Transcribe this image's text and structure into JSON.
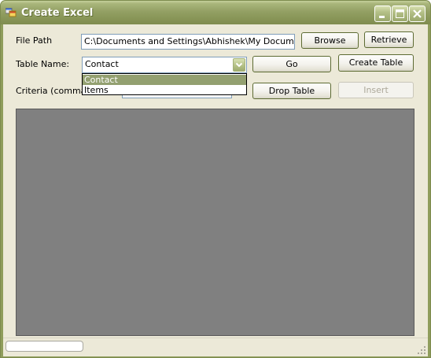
{
  "window": {
    "title": "Create Excel",
    "app_icon": "windows-form-icon",
    "caption_buttons": [
      "minimize-icon",
      "maximize-icon",
      "close-icon"
    ]
  },
  "form": {
    "file_path_label": "File Path",
    "file_path_value": "C:\\Documents and Settings\\Abhishek\\My Documents\\",
    "browse_label": "Browse",
    "retrieve_label": "Retrieve",
    "table_name_label": "Table Name:",
    "table_name_selected": "Contact",
    "go_label": "Go",
    "create_table_label": "Create Table",
    "criteria_label": "Criteria (comma se",
    "criteria_value": "",
    "drop_table_label": "Drop Table",
    "insert_label": "Insert",
    "insert_enabled": false
  },
  "dropdown": {
    "open": true,
    "options": [
      "Contact",
      "Items"
    ],
    "highlighted_index": 0
  },
  "status_bar": {
    "panel_text": ""
  },
  "colors": {
    "titlebar": "#8f9d5c",
    "dialog_background": "#ece9d8",
    "grid_background": "#808080",
    "dropdown_highlight": "#93a070"
  }
}
